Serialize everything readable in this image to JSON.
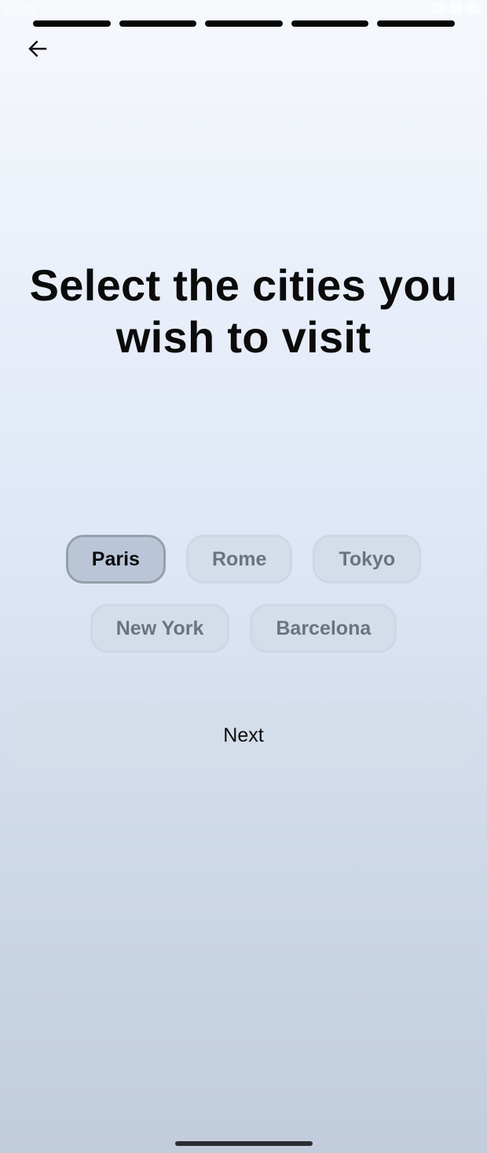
{
  "status_bar": {
    "time": "2:39",
    "icons": [
      "g-icon",
      "dnd-icon",
      "wifi-icon",
      "signal-icon",
      "battery-icon"
    ]
  },
  "progress": {
    "total_steps": 5,
    "completed_steps": 5
  },
  "header": {
    "back_icon": "arrow-left-icon"
  },
  "main": {
    "title": "Select the cities you wish to visit",
    "cities": [
      {
        "label": "Paris",
        "selected": true
      },
      {
        "label": "Rome",
        "selected": false
      },
      {
        "label": "Tokyo",
        "selected": false
      },
      {
        "label": "New York",
        "selected": false
      },
      {
        "label": "Barcelona",
        "selected": false
      }
    ]
  },
  "actions": {
    "next_label": "Next"
  },
  "colors": {
    "progress_fill": "#050505",
    "chip_selected_bg": "#bac6d8",
    "chip_unselected_bg": "#d4deeb",
    "chip_unselected_text": "#6b7280"
  }
}
